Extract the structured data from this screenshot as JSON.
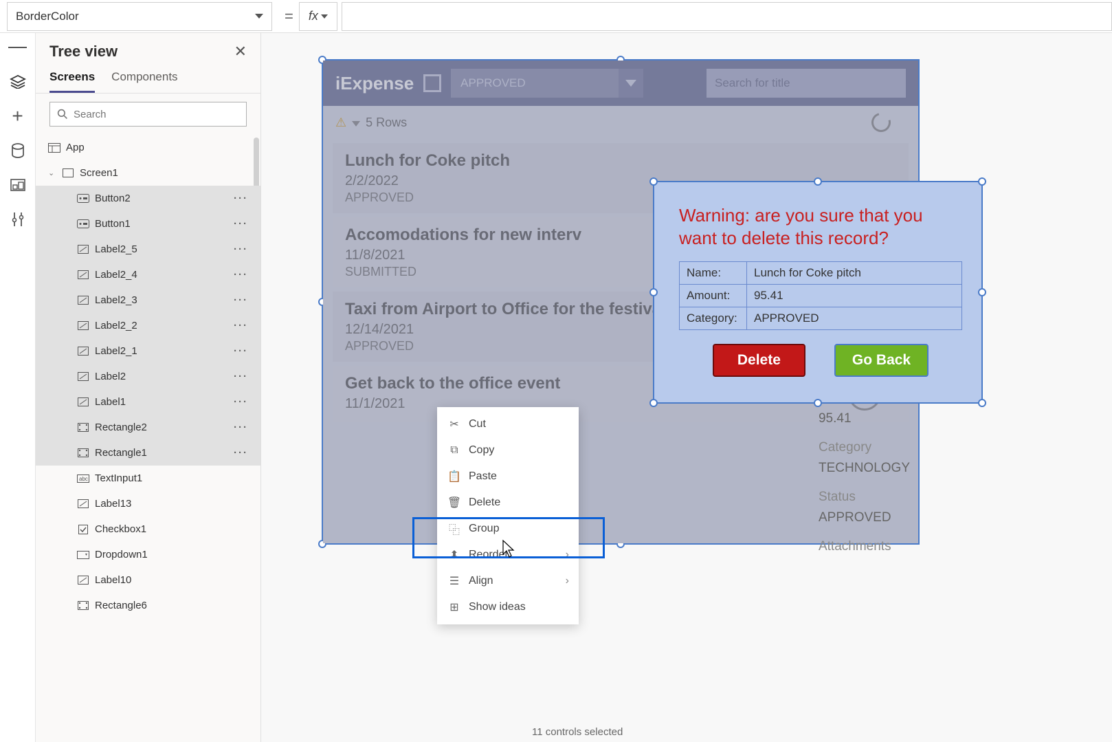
{
  "property_selector": "BorderColor",
  "tree_panel": {
    "title": "Tree view",
    "tabs": {
      "screens": "Screens",
      "components": "Components"
    },
    "search_placeholder": "Search",
    "app_label": "App",
    "screen_label": "Screen1",
    "items": [
      {
        "name": "Button2",
        "icon": "button",
        "selected": true
      },
      {
        "name": "Button1",
        "icon": "button",
        "selected": true
      },
      {
        "name": "Label2_5",
        "icon": "label",
        "selected": true
      },
      {
        "name": "Label2_4",
        "icon": "label",
        "selected": true
      },
      {
        "name": "Label2_3",
        "icon": "label",
        "selected": true
      },
      {
        "name": "Label2_2",
        "icon": "label",
        "selected": true
      },
      {
        "name": "Label2_1",
        "icon": "label",
        "selected": true
      },
      {
        "name": "Label2",
        "icon": "label",
        "selected": true
      },
      {
        "name": "Label1",
        "icon": "label",
        "selected": true
      },
      {
        "name": "Rectangle2",
        "icon": "rect",
        "selected": true
      },
      {
        "name": "Rectangle1",
        "icon": "rect",
        "selected": true
      },
      {
        "name": "TextInput1",
        "icon": "textinput",
        "selected": false
      },
      {
        "name": "Label13",
        "icon": "label",
        "selected": false
      },
      {
        "name": "Checkbox1",
        "icon": "checkbox",
        "selected": false
      },
      {
        "name": "Dropdown1",
        "icon": "dropdown",
        "selected": false
      },
      {
        "name": "Label10",
        "icon": "label",
        "selected": false
      },
      {
        "name": "Rectangle6",
        "icon": "rect",
        "selected": false
      }
    ]
  },
  "context_menu": {
    "cut": "Cut",
    "copy": "Copy",
    "paste": "Paste",
    "delete": "Delete",
    "group": "Group",
    "reorder": "Reorder",
    "align": "Align",
    "show_ideas": "Show ideas"
  },
  "canvas": {
    "app_title": "iExpense",
    "dropdown_value": "APPROVED",
    "search_placeholder": "Search for title",
    "rows_label": "5 Rows",
    "rows": [
      {
        "title": "Lunch for Coke pitch",
        "date": "2/2/2022",
        "status": "APPROVED"
      },
      {
        "title": "Accomodations for new interv",
        "date": "11/8/2021",
        "status": "SUBMITTED"
      },
      {
        "title": "Taxi from Airport to Office for the festival",
        "date": "12/14/2021",
        "status": "APPROVED"
      },
      {
        "title": "Get back to the office event",
        "date": "11/1/2021",
        "status": ""
      }
    ],
    "dialog": {
      "warning": "Warning: are you sure that you want to delete this record?",
      "name_label": "Name:",
      "name_value": "Lunch for Coke pitch",
      "amount_label": "Amount:",
      "amount_value": "95.41",
      "category_label": "Category:",
      "category_value": "APPROVED",
      "delete_btn": "Delete",
      "goback_btn": "Go Back"
    },
    "detail": {
      "amount_val": "95.41",
      "category_label": "Category",
      "category_val": "TECHNOLOGY",
      "status_label": "Status",
      "status_val": "APPROVED",
      "attachments_label": "Attachments"
    }
  },
  "status_bar": "11 controls selected"
}
